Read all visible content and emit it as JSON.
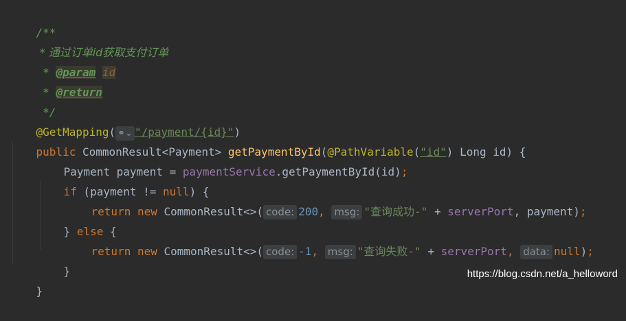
{
  "comment": {
    "open": "/**",
    "description": " * 通过订单id获取支付订单",
    "param_prefix": " * ",
    "param_tag": "@param",
    "param_name": "id",
    "return_prefix": " * ",
    "return_tag": "@return",
    "close": " */"
  },
  "mapping": {
    "annotation": "@GetMapping",
    "open_paren": "(",
    "globe_icon": "globe-icon",
    "path": "\"/payment/{id}\"",
    "close_paren": ")"
  },
  "signature": {
    "modifier": "public",
    "return_type": " CommonResult<Payment> ",
    "method": "getPaymentById",
    "open": "(",
    "param_annotation": "@PathVariable",
    "param_value_open": "(",
    "param_value": "\"id\"",
    "param_value_close": ")",
    "param_rest": " Long id) {"
  },
  "line_payment": {
    "decl": "Payment payment = ",
    "service": "paymentService",
    "call": ".getPaymentById(id)",
    "semi": ";"
  },
  "line_if": {
    "keyword": "if",
    "cond_open": " (payment != ",
    "null": "null",
    "cond_close": ") {"
  },
  "return_ok": {
    "kw_return": "return",
    "kw_new": "new",
    "type": " CommonResult<>(",
    "hint_code": "code:",
    "code": "200",
    "sep1": ", ",
    "hint_msg": "msg:",
    "msg": "\"查询成功-\"",
    "plus": " + ",
    "field": "serverPort",
    "rest": ", payment)",
    "semi": ";"
  },
  "line_else": {
    "close": "} ",
    "keyword": "else",
    "open": " {"
  },
  "return_fail": {
    "kw_return": "return",
    "kw_new": "new",
    "type": " CommonResult<>(",
    "hint_code": "code:",
    "code": "-1",
    "sep1": ", ",
    "hint_msg": "msg:",
    "msg": "\"查询失败-\"",
    "plus": " + ",
    "field": "serverPort",
    "sep2": ", ",
    "hint_data": "data:",
    "null": "null",
    "close": ")",
    "semi": ";"
  },
  "brace_inner": "}",
  "brace_outer": "}",
  "watermark": "https://blog.csdn.net/a_helloword",
  "colors": {
    "background": "#2b2b2b",
    "keyword": "#cc7832",
    "method": "#ffc66d",
    "string": "#6a8759",
    "number": "#6897bb",
    "field": "#9876aa",
    "annotation": "#bbb529",
    "comment": "#629755"
  }
}
